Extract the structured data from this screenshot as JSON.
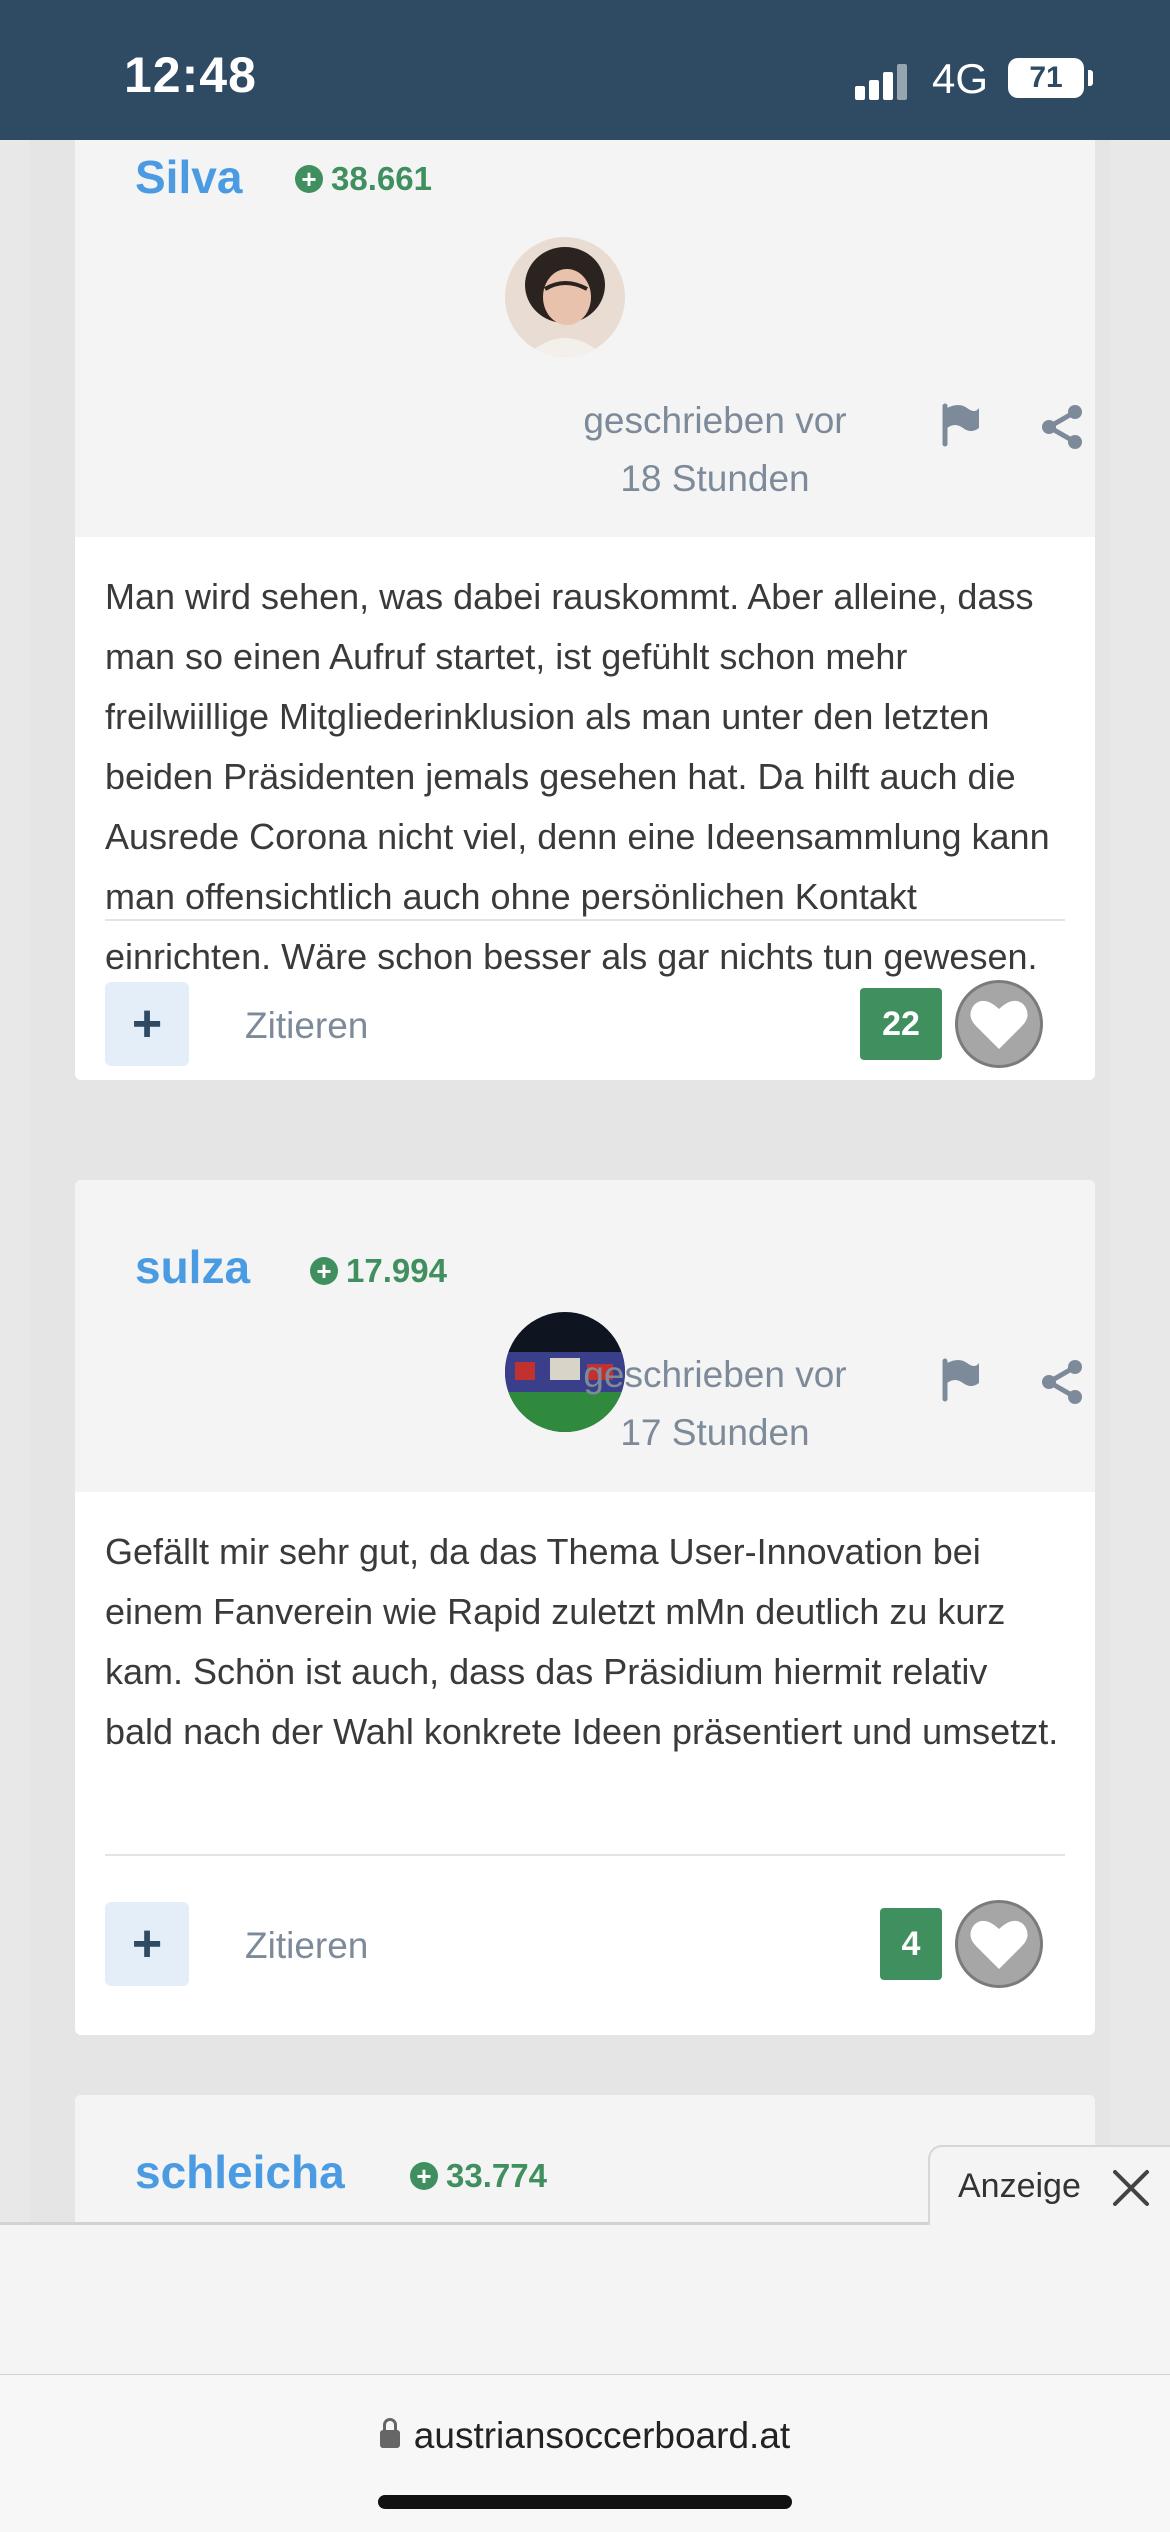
{
  "status_bar": {
    "time": "12:48",
    "network": "4G",
    "battery": "71"
  },
  "posts": [
    {
      "author": "Silva",
      "reputation": "38.661",
      "meta_line1": "geschrieben vor",
      "meta_line2": "18 Stunden",
      "body": "Man wird sehen, was dabei rauskommt. Aber alleine, dass man so einen Aufruf startet, ist gefühlt schon mehr freilwiillige Mitgliederinklusion als man unter den letzten beiden Präsidenten jemals gesehen hat. Da hilft auch die Ausrede Corona nicht viel, denn eine Ideensammlung kann man offensichtlich auch ohne persönlichen Kontakt einrichten. Wäre schon besser als gar nichts tun gewesen.",
      "plus": "+",
      "quote": "Zitieren",
      "likes": "22"
    },
    {
      "author": "sulza",
      "reputation": "17.994",
      "meta_line1": "geschrieben vor",
      "meta_line2": "17 Stunden",
      "body": "Gefällt mir sehr gut, da das Thema User-Innovation bei einem Fanverein wie Rapid zuletzt mMn deutlich zu kurz kam. Schön ist auch, dass das Präsidium hiermit relativ bald nach der Wahl konkrete Ideen präsentiert und umsetzt.",
      "plus": "+",
      "quote": "Zitieren",
      "likes": "4"
    },
    {
      "author": "schleicha",
      "reputation": "33.774"
    }
  ],
  "ad": {
    "label": "Anzeige"
  },
  "browser": {
    "url": "austriansoccerboard.at"
  },
  "colors": {
    "status_bg": "#2f4a63",
    "author": "#4b9be3",
    "reputation": "#3f8f5f",
    "likes_bg": "#3f8f5f"
  }
}
